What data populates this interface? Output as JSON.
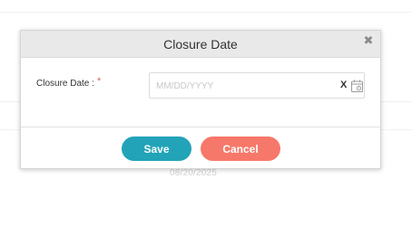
{
  "background": {
    "row_date": "08/20/2025"
  },
  "dialog": {
    "title": "Closure Date",
    "close_icon": "close-icon",
    "field": {
      "label": "Closure Date :",
      "required_marker": "*",
      "value": "",
      "placeholder": "MM/DD/YYYY",
      "clear_label": "X",
      "calendar_icon": "calendar-icon"
    },
    "buttons": {
      "save_label": "Save",
      "cancel_label": "Cancel"
    }
  },
  "colors": {
    "save": "#22a3b8",
    "cancel": "#f6786a",
    "header": "#e9e9e9",
    "required": "#e05a5a"
  }
}
